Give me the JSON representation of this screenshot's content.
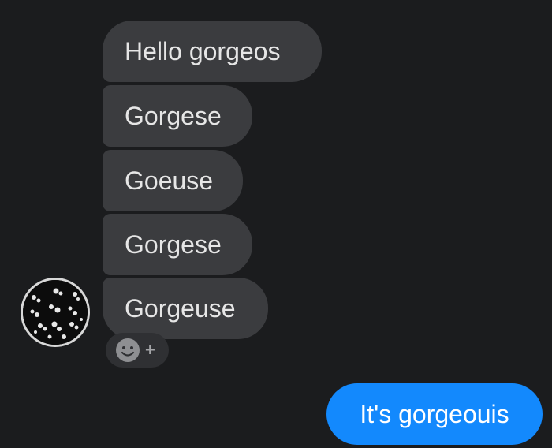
{
  "chat": {
    "received_messages": [
      {
        "text": "Hello gorgeos"
      },
      {
        "text": "Gorgese"
      },
      {
        "text": "Goeuse"
      },
      {
        "text": "Gorgese"
      },
      {
        "text": "Gorgeuse"
      }
    ],
    "reaction": {
      "icon": "smiley-face-icon",
      "add_label": "+"
    },
    "sent_message": {
      "text": "It's gorgeouis"
    },
    "avatar": {
      "icon": "contact-avatar"
    }
  },
  "colors": {
    "background": "#1b1c1e",
    "received_bubble": "#3b3c3f",
    "sent_bubble": "#1389fd",
    "received_text": "#e6e6e6",
    "sent_text": "#ffffff"
  }
}
